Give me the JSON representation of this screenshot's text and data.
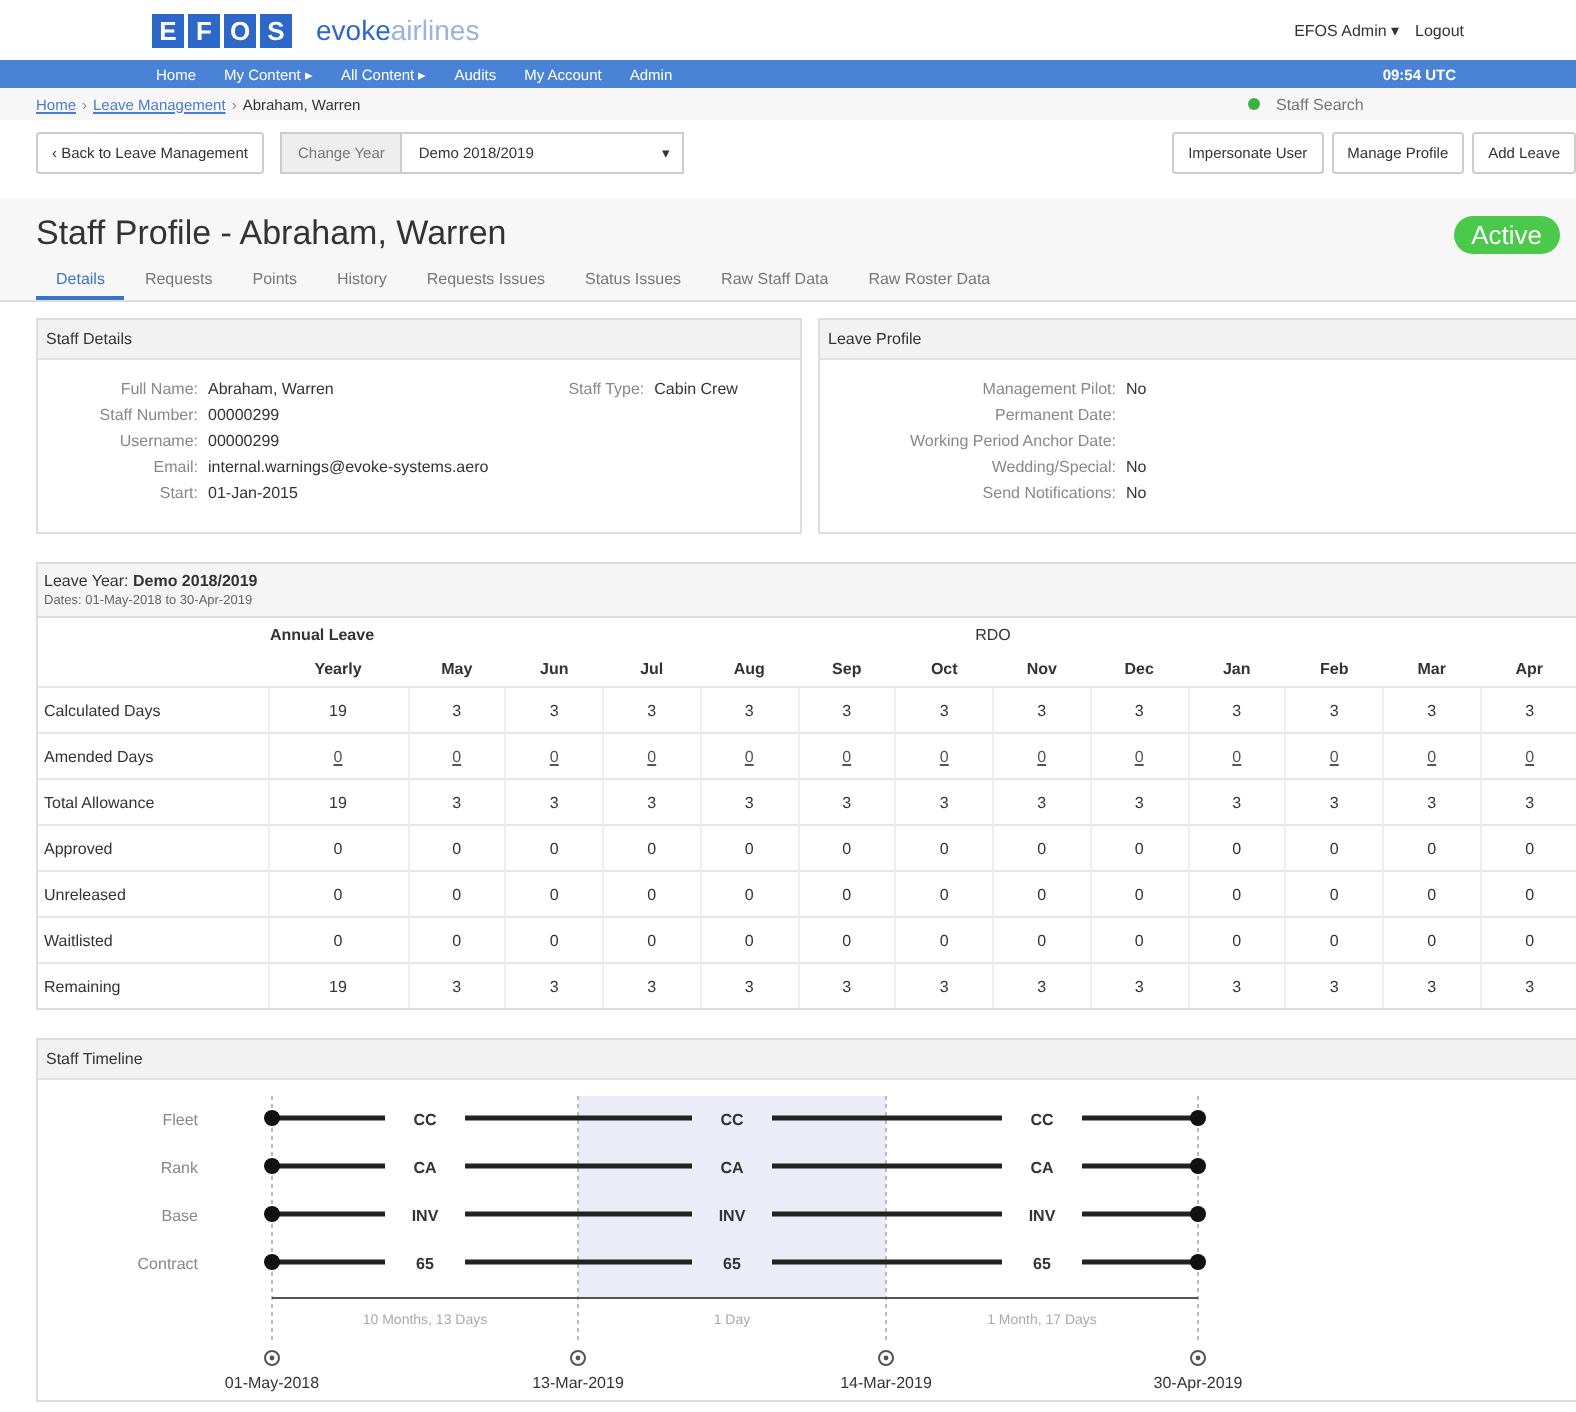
{
  "header": {
    "logo_letters": [
      "E",
      "F",
      "O",
      "S"
    ],
    "brand": {
      "main": "evoke",
      "sub": "airlines"
    },
    "user_menu": "EFOS Admin ▾",
    "logout": "Logout"
  },
  "nav": {
    "items": [
      "Home",
      "My Content ▸",
      "All Content ▸",
      "Audits",
      "My Account",
      "Admin"
    ],
    "time": "09:54 UTC"
  },
  "breadcrumb_separator": "›",
  "breadcrumb": [
    {
      "text": "Home",
      "link": true
    },
    {
      "text": "Leave Management",
      "link": true
    },
    {
      "text": "Abraham, Warren",
      "link": false
    }
  ],
  "staff_search": {
    "placeholder": "Staff Search"
  },
  "toolbar": {
    "back": "‹ Back to Leave Management",
    "change_year": "Change Year",
    "year_select": "Demo 2018/2019",
    "caret": "▾",
    "actions": [
      "Impersonate User",
      "Manage Profile",
      "Add Leave"
    ]
  },
  "title": "Staff Profile - Abraham, Warren",
  "status_badge": "Active",
  "tabs": [
    {
      "label": "Details",
      "selected": true
    },
    {
      "label": "Requests",
      "selected": false
    },
    {
      "label": "Points",
      "selected": false
    },
    {
      "label": "History",
      "selected": false
    },
    {
      "label": "Requests Issues",
      "selected": false
    },
    {
      "label": "Status Issues",
      "selected": false
    },
    {
      "label": "Raw Staff Data",
      "selected": false
    },
    {
      "label": "Raw Roster Data",
      "selected": false
    }
  ],
  "staff_details": {
    "title": "Staff Details",
    "fields": [
      {
        "label": "Full Name:",
        "value": "Abraham, Warren"
      },
      {
        "label": "Staff Number:",
        "value": "00000299"
      },
      {
        "label": "Username:",
        "value": "00000299"
      },
      {
        "label": "Email:",
        "value": "internal.warnings@evoke-systems.aero"
      },
      {
        "label": "Start:",
        "value": "01-Jan-2015"
      }
    ],
    "side_field": {
      "label": "Staff Type:",
      "value": "Cabin Crew"
    }
  },
  "leave_profile": {
    "title": "Leave Profile",
    "fields": [
      {
        "label": "Management Pilot:",
        "value": "No"
      },
      {
        "label": "Permanent Date:"
      },
      {
        "label": "Working Period Anchor Date:"
      },
      {
        "label": "Wedding/Special:",
        "value": "No"
      },
      {
        "label": "Send Notifications:",
        "value": "No"
      }
    ]
  },
  "leave_year": {
    "title": "Leave Year: ",
    "year": "Demo 2018/2019",
    "dates": "Dates: 01-May-2018 to 30-Apr-2019",
    "groups": [
      "Annual Leave",
      "RDO"
    ],
    "columns": [
      "Yearly",
      "May",
      "Jun",
      "Jul",
      "Aug",
      "Sep",
      "Oct",
      "Nov",
      "Dec",
      "Jan",
      "Feb",
      "Mar",
      "Apr"
    ],
    "rows": [
      {
        "label": "Calculated Days",
        "kind": "plain",
        "values": [
          "19",
          "3",
          "3",
          "3",
          "3",
          "3",
          "3",
          "3",
          "3",
          "3",
          "3",
          "3",
          "3"
        ]
      },
      {
        "label": "Amended Days",
        "kind": "link",
        "values": [
          "0",
          "0",
          "0",
          "0",
          "0",
          "0",
          "0",
          "0",
          "0",
          "0",
          "0",
          "0",
          "0"
        ]
      },
      {
        "label": "Total Allowance",
        "kind": "plain",
        "values": [
          "19",
          "3",
          "3",
          "3",
          "3",
          "3",
          "3",
          "3",
          "3",
          "3",
          "3",
          "3",
          "3"
        ]
      },
      {
        "label": "Approved",
        "kind": "plain",
        "values": [
          "0",
          "0",
          "0",
          "0",
          "0",
          "0",
          "0",
          "0",
          "0",
          "0",
          "0",
          "0",
          "0"
        ]
      },
      {
        "label": "Unreleased",
        "kind": "plain",
        "values": [
          "0",
          "0",
          "0",
          "0",
          "0",
          "0",
          "0",
          "0",
          "0",
          "0",
          "0",
          "0",
          "0"
        ]
      },
      {
        "label": "Waitlisted",
        "kind": "plain",
        "values": [
          "0",
          "0",
          "0",
          "0",
          "0",
          "0",
          "0",
          "0",
          "0",
          "0",
          "0",
          "0",
          "0"
        ]
      },
      {
        "label": "Remaining",
        "kind": "plain",
        "values": [
          "19",
          "3",
          "3",
          "3",
          "3",
          "3",
          "3",
          "3",
          "3",
          "3",
          "3",
          "3",
          "3"
        ]
      }
    ]
  },
  "timeline": {
    "title": "Staff Timeline",
    "rows": [
      {
        "label": "Fleet",
        "values": [
          "CC",
          "CC",
          "CC"
        ]
      },
      {
        "label": "Rank",
        "values": [
          "CA",
          "CA",
          "CA"
        ]
      },
      {
        "label": "Base",
        "values": [
          "INV",
          "INV",
          "INV"
        ]
      },
      {
        "label": "Contract",
        "values": [
          "65",
          "65",
          "65"
        ]
      }
    ],
    "periods": [
      {
        "duration": "10 Months, 13 Days",
        "selected": false
      },
      {
        "duration": "1 Day",
        "selected": true
      },
      {
        "duration": "1 Month, 17 Days",
        "selected": false
      }
    ],
    "dates": [
      "01-May-2018",
      "13-Mar-2019",
      "14-Mar-2019",
      "30-Apr-2019"
    ]
  }
}
